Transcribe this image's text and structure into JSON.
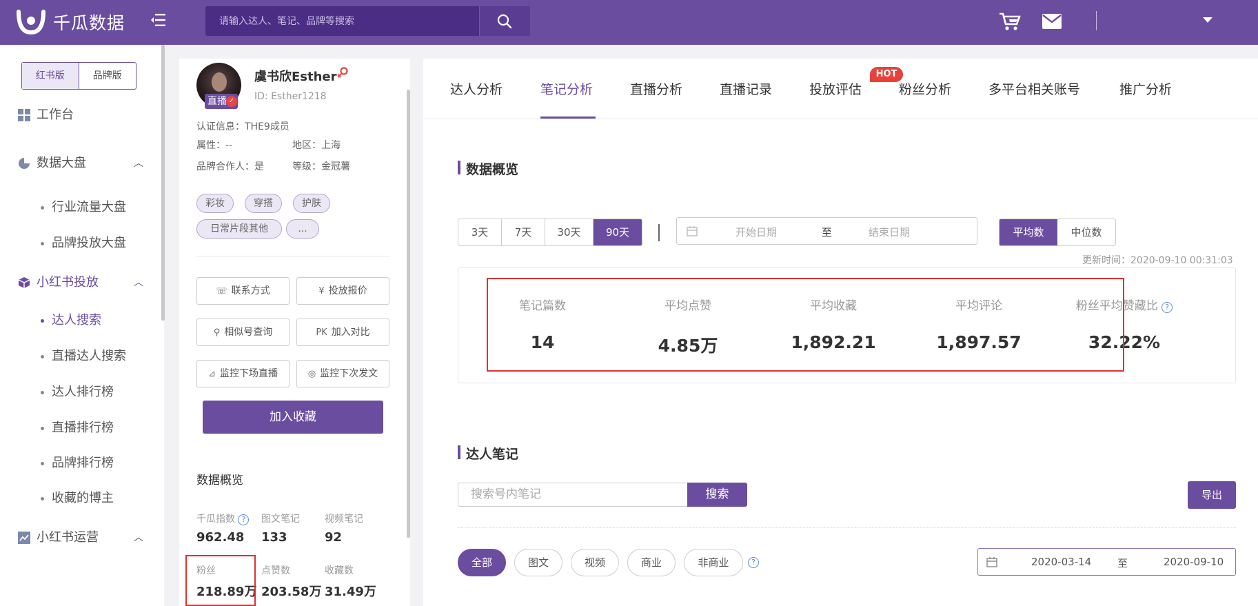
{
  "brand": {
    "name": "千瓜数据"
  },
  "search": {
    "placeholder": "请输入达人、笔记、品牌等搜索"
  },
  "sidebar": {
    "version_tabs": [
      "红书版",
      "品牌版"
    ],
    "items": [
      {
        "label": "工作台"
      },
      {
        "label": "数据大盘",
        "children": [
          "行业流量大盘",
          "品牌投放大盘"
        ]
      },
      {
        "label": "小红书投放",
        "children": [
          "达人搜索",
          "直播达人搜索",
          "达人排行榜",
          "直播排行榜",
          "品牌排行榜",
          "收藏的博主"
        ]
      },
      {
        "label": "小红书运营"
      }
    ]
  },
  "profile": {
    "name": "虞书欣Esther",
    "id": "ID:  Esther1218",
    "live_badge": "直播",
    "cert": "认证信息：THE9成员",
    "attr": "属性：--",
    "region": "地区：上海",
    "brand_partner": "品牌合作人：是",
    "level": "等级：金冠薯",
    "tags": [
      "彩妆",
      "穿搭",
      "护肤",
      "日常片段其他",
      "..."
    ],
    "actions": [
      "联系方式",
      "投放报价",
      "相似号查询",
      "加入对比",
      "监控下场直播",
      "监控下次发文"
    ],
    "favorite_label": "加入收藏",
    "overview_title": "数据概览",
    "stats": [
      {
        "label": "千瓜指数",
        "value": "962.48"
      },
      {
        "label": "图文笔记",
        "value": "133"
      },
      {
        "label": "视频笔记",
        "value": "92"
      },
      {
        "label": "粉丝",
        "value": "218.89万"
      },
      {
        "label": "点赞数",
        "value": "203.58万"
      },
      {
        "label": "收藏数",
        "value": "31.49万"
      }
    ]
  },
  "main": {
    "tabs": [
      "达人分析",
      "笔记分析",
      "直播分析",
      "直播记录",
      "投放评估",
      "粉丝分析",
      "多平台相关账号",
      "推广分析"
    ],
    "hot": "HOT",
    "overview_title": "数据概览",
    "ranges": [
      "3天",
      "7天",
      "30天",
      "90天"
    ],
    "date_start_ph": "开始日期",
    "date_to": "至",
    "date_end_ph": "结束日期",
    "avg_modes": [
      "平均数",
      "中位数"
    ],
    "update_time": "更新时间：2020-09-10 00:31:03",
    "metrics": [
      {
        "label": "笔记篇数",
        "value": "14"
      },
      {
        "label": "平均点赞",
        "value": "4.85万"
      },
      {
        "label": "平均收藏",
        "value": "1,892.21"
      },
      {
        "label": "平均评论",
        "value": "1,897.57"
      },
      {
        "label": "粉丝平均赞藏比",
        "value": "32.22%"
      }
    ],
    "notes_title": "达人笔记",
    "notes_search_ph": "搜索号内笔记",
    "notes_search_btn": "搜索",
    "export": "导出",
    "filters": [
      "全部",
      "图文",
      "视频",
      "商业",
      "非商业"
    ],
    "date_from": "2020-03-14",
    "date_to_val": "2020-09-10"
  },
  "colors": {
    "brand": "#6b4da0",
    "highlight": "#e03030"
  }
}
